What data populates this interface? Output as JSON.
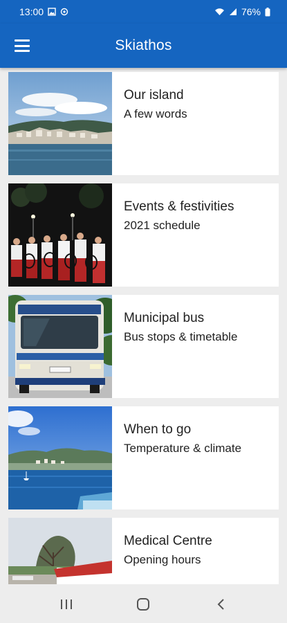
{
  "status_bar": {
    "time": "13:00",
    "battery": "76%",
    "icons": [
      "image-icon",
      "sync-icon",
      "wifi-icon",
      "signal-icon",
      "battery-icon"
    ]
  },
  "app_bar": {
    "title": "Skiathos",
    "menu_icon": "hamburger-menu-icon"
  },
  "cards": [
    {
      "title": "Our island",
      "subtitle": "A few words",
      "image": "island-harbor-photo"
    },
    {
      "title": "Events & festivities",
      "subtitle": "2021 schedule",
      "image": "festival-dancers-photo"
    },
    {
      "title": "Municipal bus",
      "subtitle": "Bus stops & timetable",
      "image": "bus-photo"
    },
    {
      "title": "When to go",
      "subtitle": "Temperature & climate",
      "image": "sea-view-photo"
    },
    {
      "title": "Medical Centre",
      "subtitle": "Opening hours",
      "image": "medical-centre-photo"
    }
  ],
  "nav_bar": {
    "icons": [
      "recent-apps-icon",
      "home-icon",
      "back-icon"
    ]
  },
  "colors": {
    "primary": "#1565c0",
    "background": "#ededed",
    "card": "#ffffff",
    "text": "#222222"
  }
}
